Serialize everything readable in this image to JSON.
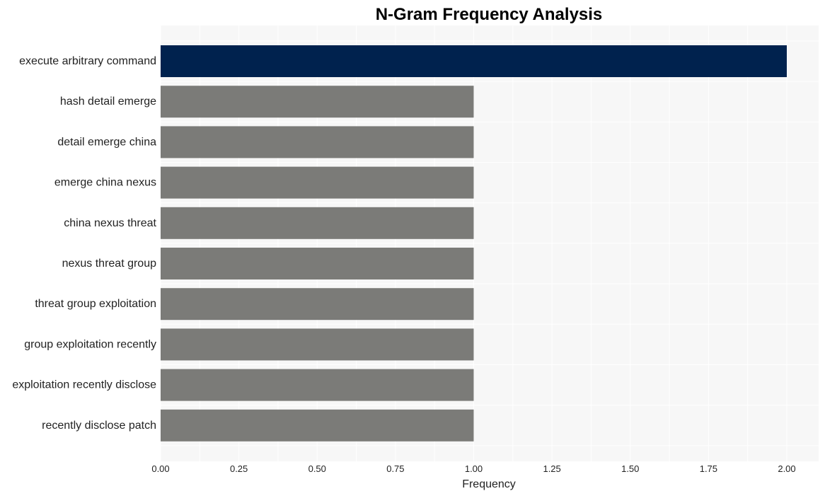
{
  "chart_data": {
    "type": "bar",
    "orientation": "horizontal",
    "title": "N-Gram Frequency Analysis",
    "xlabel": "Frequency",
    "ylabel": "",
    "xlim": [
      0,
      2.1
    ],
    "x_ticks": [
      "0.00",
      "0.25",
      "0.50",
      "0.75",
      "1.00",
      "1.25",
      "1.50",
      "1.75",
      "2.00"
    ],
    "x_tick_values": [
      0,
      0.25,
      0.5,
      0.75,
      1.0,
      1.25,
      1.5,
      1.75,
      2.0
    ],
    "grid": true,
    "categories": [
      "execute arbitrary command",
      "hash detail emerge",
      "detail emerge china",
      "emerge china nexus",
      "china nexus threat",
      "nexus threat group",
      "threat group exploitation",
      "group exploitation recently",
      "exploitation recently disclose",
      "recently disclose patch"
    ],
    "values": [
      2,
      1,
      1,
      1,
      1,
      1,
      1,
      1,
      1,
      1
    ],
    "colors": {
      "highlight": "#00224e",
      "default": "#7b7b78",
      "plot_background": "#f7f7f7",
      "grid": "#ffffff"
    }
  }
}
